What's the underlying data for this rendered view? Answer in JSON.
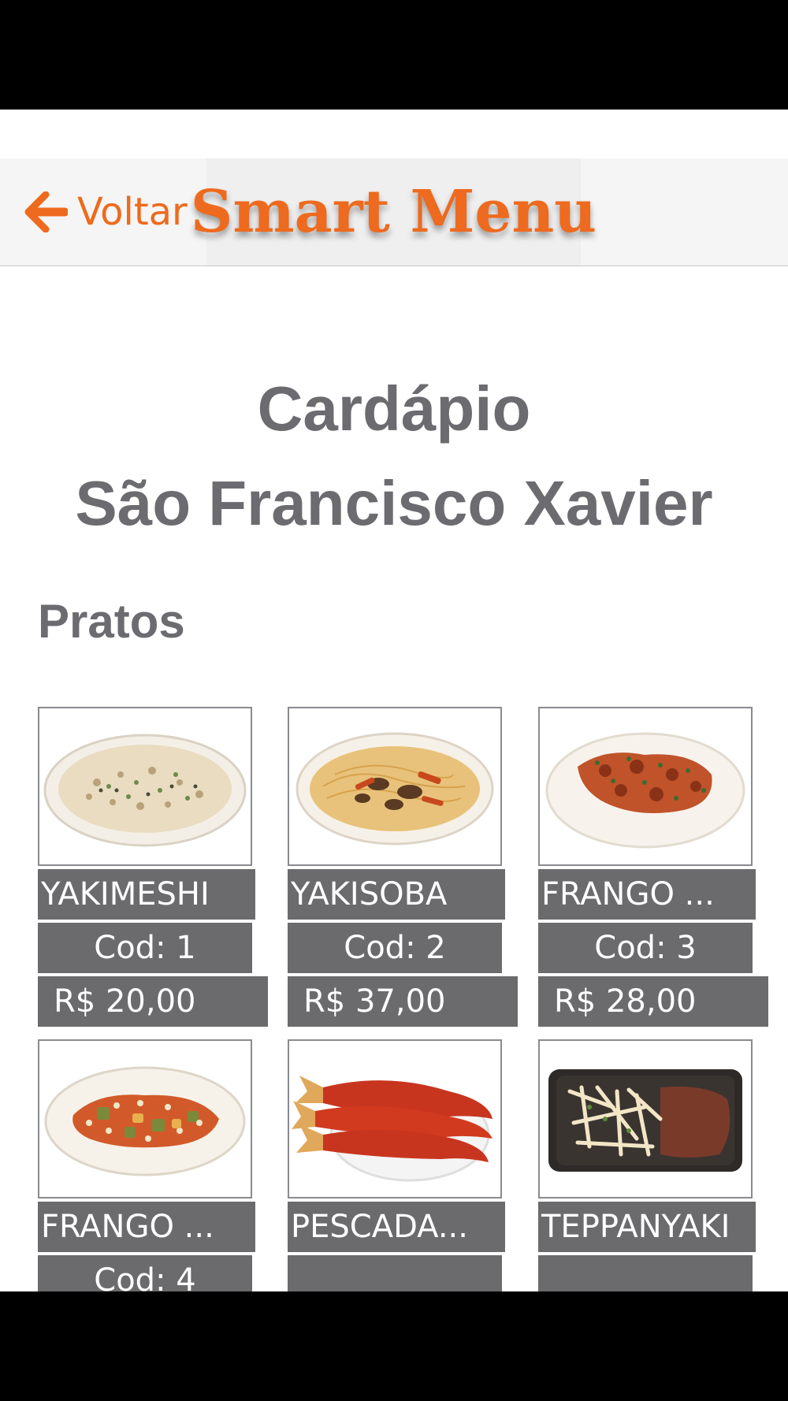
{
  "nav": {
    "back_label": "Voltar",
    "brand": "Smart Menu",
    "accent_color": "#ee6a1e"
  },
  "page": {
    "title_line1": "Cardápio",
    "title_line2": "São Francisco Xavier",
    "section": "Pratos"
  },
  "dishes": [
    {
      "name": "YAKIMESHI",
      "code": "Cod:  1",
      "price": "R$  20,00",
      "image": "fried-rice-plate"
    },
    {
      "name": "YAKISOBA",
      "code": "Cod:  2",
      "price": "R$  37,00",
      "image": "noodles-plate"
    },
    {
      "name": "FRANGO ...",
      "code": "Cod:  3",
      "price": "R$  28,00",
      "image": "chicken-plate"
    },
    {
      "name": "FRANGO ...",
      "code": "Cod:  4",
      "price": "",
      "image": "chicken-vegetables-plate"
    },
    {
      "name": "PESCADA...",
      "code": "",
      "price": "",
      "image": "fish-plate"
    },
    {
      "name": "TEPPANYAKI",
      "code": "",
      "price": "",
      "image": "teppanyaki-platter"
    }
  ]
}
